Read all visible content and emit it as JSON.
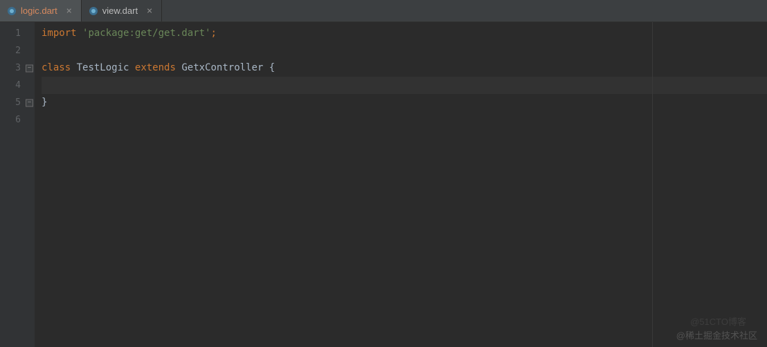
{
  "tabs": [
    {
      "name": "logic.dart",
      "active": true
    },
    {
      "name": "view.dart",
      "active": false
    }
  ],
  "gutter": {
    "lines": [
      "1",
      "2",
      "3",
      "4",
      "5",
      "6"
    ]
  },
  "code": {
    "line1": {
      "kw_import": "import",
      "sp1": " ",
      "str": "'package:get/get.dart'",
      "semi": ";"
    },
    "line3": {
      "kw_class": "class",
      "sp1": " ",
      "name": "TestLogic",
      "sp2": " ",
      "kw_extends": "extends",
      "sp3": " ",
      "base": "GetxController",
      "sp4": " ",
      "brace": "{"
    },
    "line5": {
      "brace": "}"
    }
  },
  "fold": {
    "minus": "−"
  },
  "watermark": "@稀土掘金技术社区",
  "watermark2": "@51CTO博客"
}
